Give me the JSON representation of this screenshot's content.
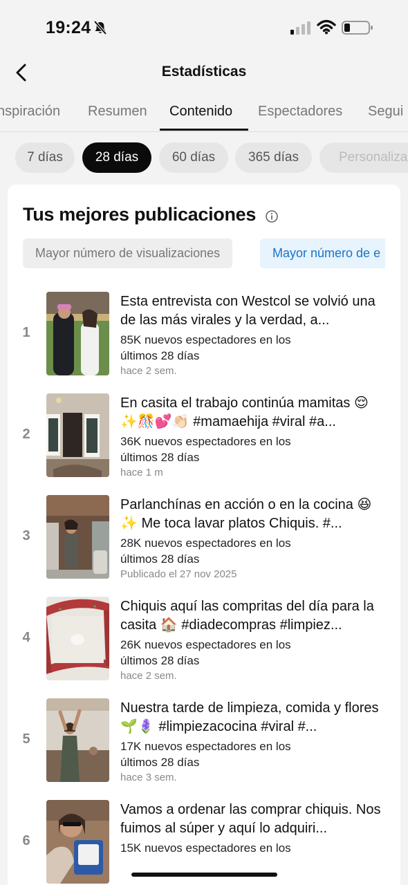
{
  "status": {
    "time": "19:24"
  },
  "header": {
    "title": "Estadísticas"
  },
  "tabs": [
    "nspiración",
    "Resumen",
    "Contenido",
    "Espectadores",
    "Segui"
  ],
  "chips": [
    "7 días",
    "28 días",
    "60 días",
    "365 días",
    "Personaliza"
  ],
  "section": {
    "title": "Tus mejores publicaciones",
    "filter_views": "Mayor número de visualizaciones",
    "filter_other": "Mayor número de e"
  },
  "posts": [
    {
      "rank": "1",
      "title": "Esta entrevista con Westcol se volvió una de las más virales y la verdad, a...",
      "views": "85K nuevos espectadores en los últimos 28 días",
      "date": "hace 2 sem."
    },
    {
      "rank": "2",
      "title": "En casita el trabajo continúa mamitas 😌✨🎊💕👏🏻 #mamaehija #viral #a...",
      "views": "36K nuevos espectadores en los últimos 28 días",
      "date": "hace 1 m"
    },
    {
      "rank": "3",
      "title": "Parlanchínas en acción o en la cocina 😆✨ Me toca lavar platos Chiquis. #...",
      "views": "28K nuevos espectadores en los últimos 28 días",
      "date": "Publicado el 27 nov 2025"
    },
    {
      "rank": "4",
      "title": "Chiquis aquí las compritas del día para la casita 🏠 #diadecompras #limpiez...",
      "views": "26K nuevos espectadores en los últimos 28 días",
      "date": "hace 2 sem."
    },
    {
      "rank": "5",
      "title": "Nuestra tarde de limpieza, comida y flores 🌱🪻 #limpiezacocina #viral #...",
      "views": "17K nuevos espectadores en los últimos 28 días",
      "date": "hace 3 sem."
    },
    {
      "rank": "6",
      "title": "Vamos a ordenar las comprar chiquis. Nos fuimos al súper y aquí lo adquiri...",
      "views": "15K nuevos espectadores en los",
      "date": ""
    }
  ]
}
